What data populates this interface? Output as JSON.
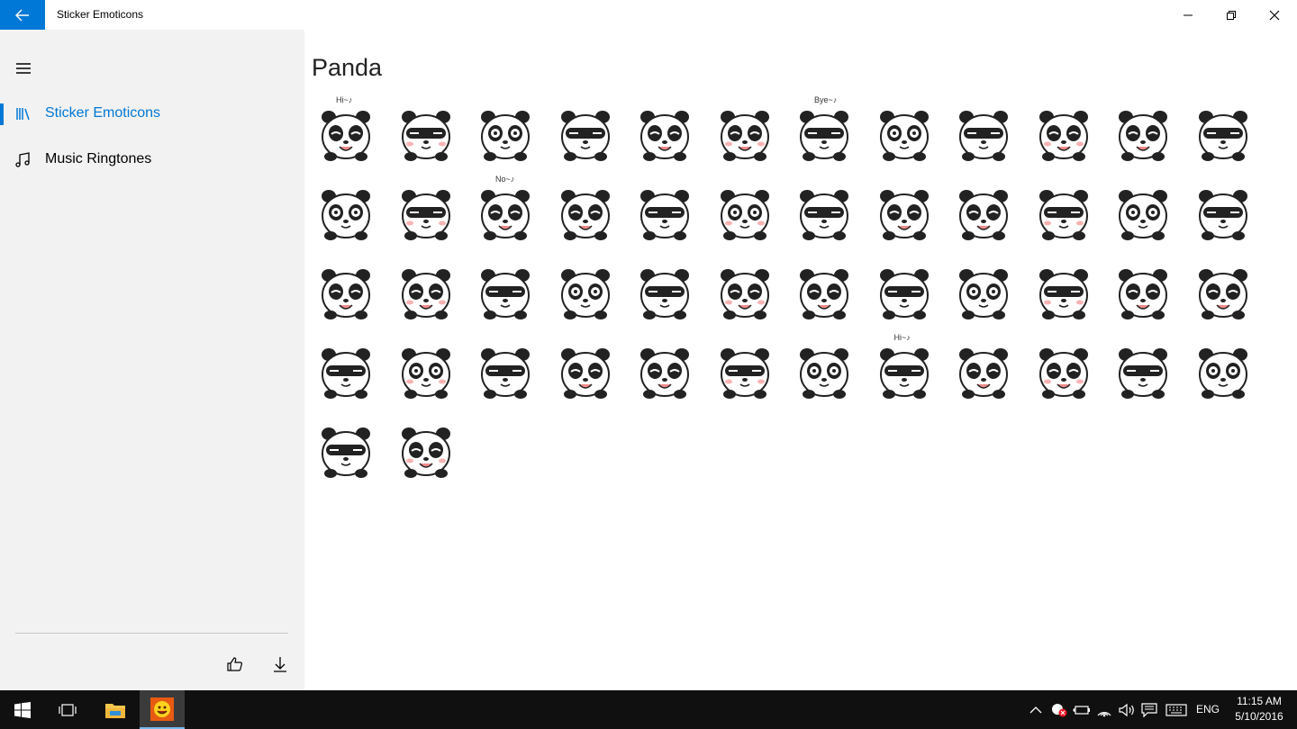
{
  "window": {
    "title": "Sticker Emoticons"
  },
  "sidebar": {
    "items": [
      {
        "label": "Sticker Emoticons",
        "icon": "library-icon",
        "selected": true
      },
      {
        "label": "Music Ringtones",
        "icon": "music-note-icon",
        "selected": false
      }
    ],
    "footer_buttons": [
      {
        "icon": "thumbs-up-icon"
      },
      {
        "icon": "download-icon"
      }
    ]
  },
  "main": {
    "title": "Panda",
    "sticker_count": 50,
    "sticker_captions": {
      "hi": "Hi~♪",
      "bye": "Bye~♪",
      "no": "No~♪"
    }
  },
  "taskbar": {
    "language": "ENG",
    "time": "11:15 AM",
    "date": "5/10/2016"
  },
  "colors": {
    "accent": "#0078d7",
    "sidebar_bg": "#f2f2f2",
    "taskbar_bg": "#101010"
  }
}
